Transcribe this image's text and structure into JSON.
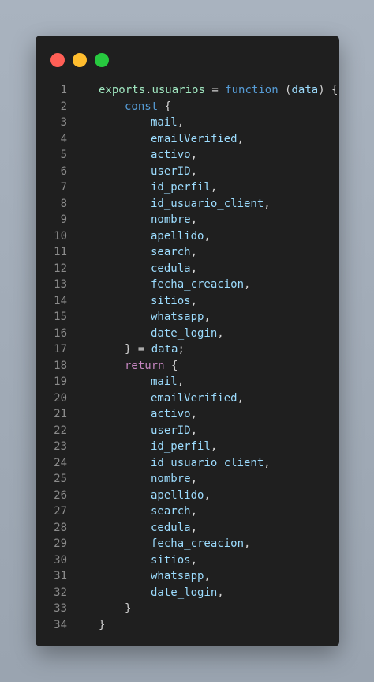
{
  "window": {
    "buttons": {
      "close_color": "#ff5f56",
      "minimize_color": "#ffbd2e",
      "maximize_color": "#27c93f"
    }
  },
  "code": {
    "lines": [
      {
        "n": "1",
        "indent": 0,
        "parts": [
          [
            "exports",
            "export"
          ],
          [
            ".",
            "punc"
          ],
          [
            "usuarios",
            "export"
          ],
          [
            " = ",
            "punc"
          ],
          [
            "function",
            "func"
          ],
          [
            " (",
            "punc"
          ],
          [
            "data",
            "ident"
          ],
          [
            ") {",
            "punc"
          ]
        ]
      },
      {
        "n": "2",
        "indent": 1,
        "parts": [
          [
            "const",
            "func"
          ],
          [
            " {",
            "punc"
          ]
        ]
      },
      {
        "n": "3",
        "indent": 2,
        "parts": [
          [
            "mail",
            "ident"
          ],
          [
            ",",
            "punc"
          ]
        ]
      },
      {
        "n": "4",
        "indent": 2,
        "parts": [
          [
            "emailVerified",
            "ident"
          ],
          [
            ",",
            "punc"
          ]
        ]
      },
      {
        "n": "5",
        "indent": 2,
        "parts": [
          [
            "activo",
            "ident"
          ],
          [
            ",",
            "punc"
          ]
        ]
      },
      {
        "n": "6",
        "indent": 2,
        "parts": [
          [
            "userID",
            "ident"
          ],
          [
            ",",
            "punc"
          ]
        ]
      },
      {
        "n": "7",
        "indent": 2,
        "parts": [
          [
            "id_perfil",
            "ident"
          ],
          [
            ",",
            "punc"
          ]
        ]
      },
      {
        "n": "8",
        "indent": 2,
        "parts": [
          [
            "id_usuario_client",
            "ident"
          ],
          [
            ",",
            "punc"
          ]
        ]
      },
      {
        "n": "9",
        "indent": 2,
        "parts": [
          [
            "nombre",
            "ident"
          ],
          [
            ",",
            "punc"
          ]
        ]
      },
      {
        "n": "10",
        "indent": 2,
        "parts": [
          [
            "apellido",
            "ident"
          ],
          [
            ",",
            "punc"
          ]
        ]
      },
      {
        "n": "11",
        "indent": 2,
        "parts": [
          [
            "search",
            "ident"
          ],
          [
            ",",
            "punc"
          ]
        ]
      },
      {
        "n": "12",
        "indent": 2,
        "parts": [
          [
            "cedula",
            "ident"
          ],
          [
            ",",
            "punc"
          ]
        ]
      },
      {
        "n": "13",
        "indent": 2,
        "parts": [
          [
            "fecha_creacion",
            "ident"
          ],
          [
            ",",
            "punc"
          ]
        ]
      },
      {
        "n": "14",
        "indent": 2,
        "parts": [
          [
            "sitios",
            "ident"
          ],
          [
            ",",
            "punc"
          ]
        ]
      },
      {
        "n": "15",
        "indent": 2,
        "parts": [
          [
            "whatsapp",
            "ident"
          ],
          [
            ",",
            "punc"
          ]
        ]
      },
      {
        "n": "16",
        "indent": 2,
        "parts": [
          [
            "date_login",
            "ident"
          ],
          [
            ",",
            "punc"
          ]
        ]
      },
      {
        "n": "17",
        "indent": 1,
        "parts": [
          [
            "} = ",
            "punc"
          ],
          [
            "data",
            "ident"
          ],
          [
            ";",
            "punc"
          ]
        ]
      },
      {
        "n": "18",
        "indent": 1,
        "parts": [
          [
            "return",
            "keyword"
          ],
          [
            " {",
            "punc"
          ]
        ]
      },
      {
        "n": "19",
        "indent": 2,
        "parts": [
          [
            "mail",
            "ident"
          ],
          [
            ",",
            "punc"
          ]
        ]
      },
      {
        "n": "20",
        "indent": 2,
        "parts": [
          [
            "emailVerified",
            "ident"
          ],
          [
            ",",
            "punc"
          ]
        ]
      },
      {
        "n": "21",
        "indent": 2,
        "parts": [
          [
            "activo",
            "ident"
          ],
          [
            ",",
            "punc"
          ]
        ]
      },
      {
        "n": "22",
        "indent": 2,
        "parts": [
          [
            "userID",
            "ident"
          ],
          [
            ",",
            "punc"
          ]
        ]
      },
      {
        "n": "23",
        "indent": 2,
        "parts": [
          [
            "id_perfil",
            "ident"
          ],
          [
            ",",
            "punc"
          ]
        ]
      },
      {
        "n": "24",
        "indent": 2,
        "parts": [
          [
            "id_usuario_client",
            "ident"
          ],
          [
            ",",
            "punc"
          ]
        ]
      },
      {
        "n": "25",
        "indent": 2,
        "parts": [
          [
            "nombre",
            "ident"
          ],
          [
            ",",
            "punc"
          ]
        ]
      },
      {
        "n": "26",
        "indent": 2,
        "parts": [
          [
            "apellido",
            "ident"
          ],
          [
            ",",
            "punc"
          ]
        ]
      },
      {
        "n": "27",
        "indent": 2,
        "parts": [
          [
            "search",
            "ident"
          ],
          [
            ",",
            "punc"
          ]
        ]
      },
      {
        "n": "28",
        "indent": 2,
        "parts": [
          [
            "cedula",
            "ident"
          ],
          [
            ",",
            "punc"
          ]
        ]
      },
      {
        "n": "29",
        "indent": 2,
        "parts": [
          [
            "fecha_creacion",
            "ident"
          ],
          [
            ",",
            "punc"
          ]
        ]
      },
      {
        "n": "30",
        "indent": 2,
        "parts": [
          [
            "sitios",
            "ident"
          ],
          [
            ",",
            "punc"
          ]
        ]
      },
      {
        "n": "31",
        "indent": 2,
        "parts": [
          [
            "whatsapp",
            "ident"
          ],
          [
            ",",
            "punc"
          ]
        ]
      },
      {
        "n": "32",
        "indent": 2,
        "parts": [
          [
            "date_login",
            "ident"
          ],
          [
            ",",
            "punc"
          ]
        ]
      },
      {
        "n": "33",
        "indent": 1,
        "parts": [
          [
            "}",
            "punc"
          ]
        ]
      },
      {
        "n": "34",
        "indent": 0,
        "parts": [
          [
            "}",
            "punc"
          ]
        ]
      }
    ]
  }
}
